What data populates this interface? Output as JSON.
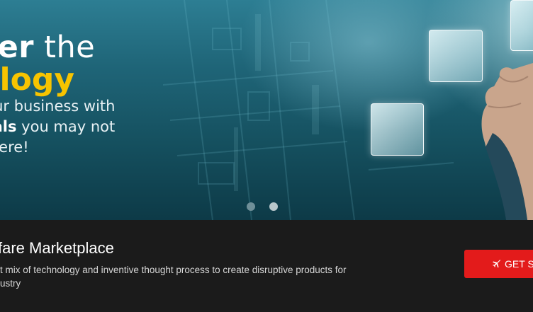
{
  "hero": {
    "line1_bold": "over",
    "line1_rest": " the",
    "line2": "nology",
    "line3": "te your business with",
    "line4_bold": "d deals",
    "line4_rest": " you may not",
    "line5": "lsewhere!",
    "carousel": {
      "slide_count": 2,
      "active_index": 1
    },
    "colors": {
      "headline_accent": "#f7c400",
      "background": "#1f6578"
    }
  },
  "marketplace": {
    "title": "fare Marketplace",
    "description": "t mix of technology and inventive thought process to create disruptive products for ustry",
    "cta_label": "GET ST",
    "cta_icon": "plane-icon",
    "colors": {
      "cta_background": "#e31b1b",
      "strip_background": "#1b1b1b"
    }
  }
}
